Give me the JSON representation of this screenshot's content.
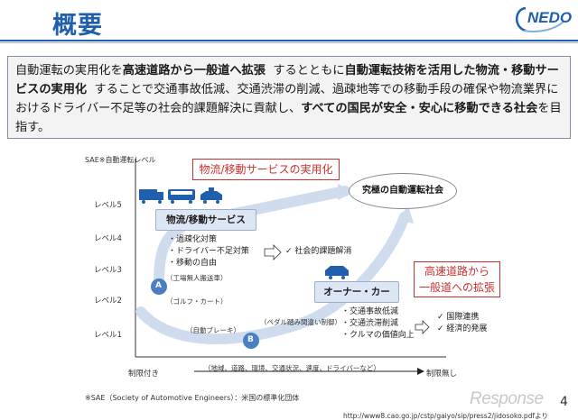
{
  "header": {
    "title": "概要",
    "logo_text": "NEDO"
  },
  "summary": {
    "s1": "自動運転の実用化を",
    "b1": "高速道路から一般道へ拡張",
    "s2": "するとともに",
    "b2": "自動運転技術を活用した物流・移動サービスの実用化",
    "s3": "することで交通事故低減、交通渋滞の削減、過疎地等での移動手段の確保や物流業界におけるドライバー不足等の社会的課題解決に貢献し、",
    "b3": "すべての国民が安全・安心に移動できる社会",
    "s4": "を目指す。"
  },
  "diagram": {
    "y_axis_title": "SAE※自動運転レベル",
    "levels": [
      "レベル5",
      "レベル4",
      "レベル3",
      "レベル2",
      "レベル1"
    ],
    "x_left": "制限付き",
    "x_right": "制限無し",
    "x_middle": "（地域、道路、環境、交通状況、速度、ドライバーなど）",
    "logistics_highlight": "物流/移動サービスの実用化",
    "logistics_box": "物流/移動サービス",
    "logistics_bullets": [
      "過疎化対策",
      "ドライバー不足対策",
      "移動の自由"
    ],
    "logistics_result": "社会的課題解消",
    "ultimate": "究極の自動運転社会",
    "owner_box": "オーナー・カー",
    "owner_highlight_1": "高速道路から",
    "owner_highlight_2": "一般道への拡張",
    "owner_bullets": [
      "交通事故低減",
      "交通渋滞削減",
      "クルマの価値向上"
    ],
    "owner_results": [
      "国際連携",
      "経済的発展"
    ],
    "point_a": "A",
    "point_b": "B",
    "note_factory": "（工場無人搬送車）",
    "note_golf": "（ゴルフ・カート）",
    "note_auto_brake": "（自動ブレーキ）",
    "note_pedal": "（ペダル踏み間違い制御）"
  },
  "footer": {
    "note": "※SAE（Society of Automotive Engineers）：米国の標準化団体",
    "url": "http://www8.cao.go.jp/cstp/gaiyo/sip/press2/jidosoko.pdfより",
    "brand": "Response",
    "page": "4"
  },
  "colors": {
    "accent": "#1f5fae",
    "highlight_red": "#c8302e",
    "box_fill": "#dde6f3",
    "arrow_light": "#cfdcee"
  }
}
